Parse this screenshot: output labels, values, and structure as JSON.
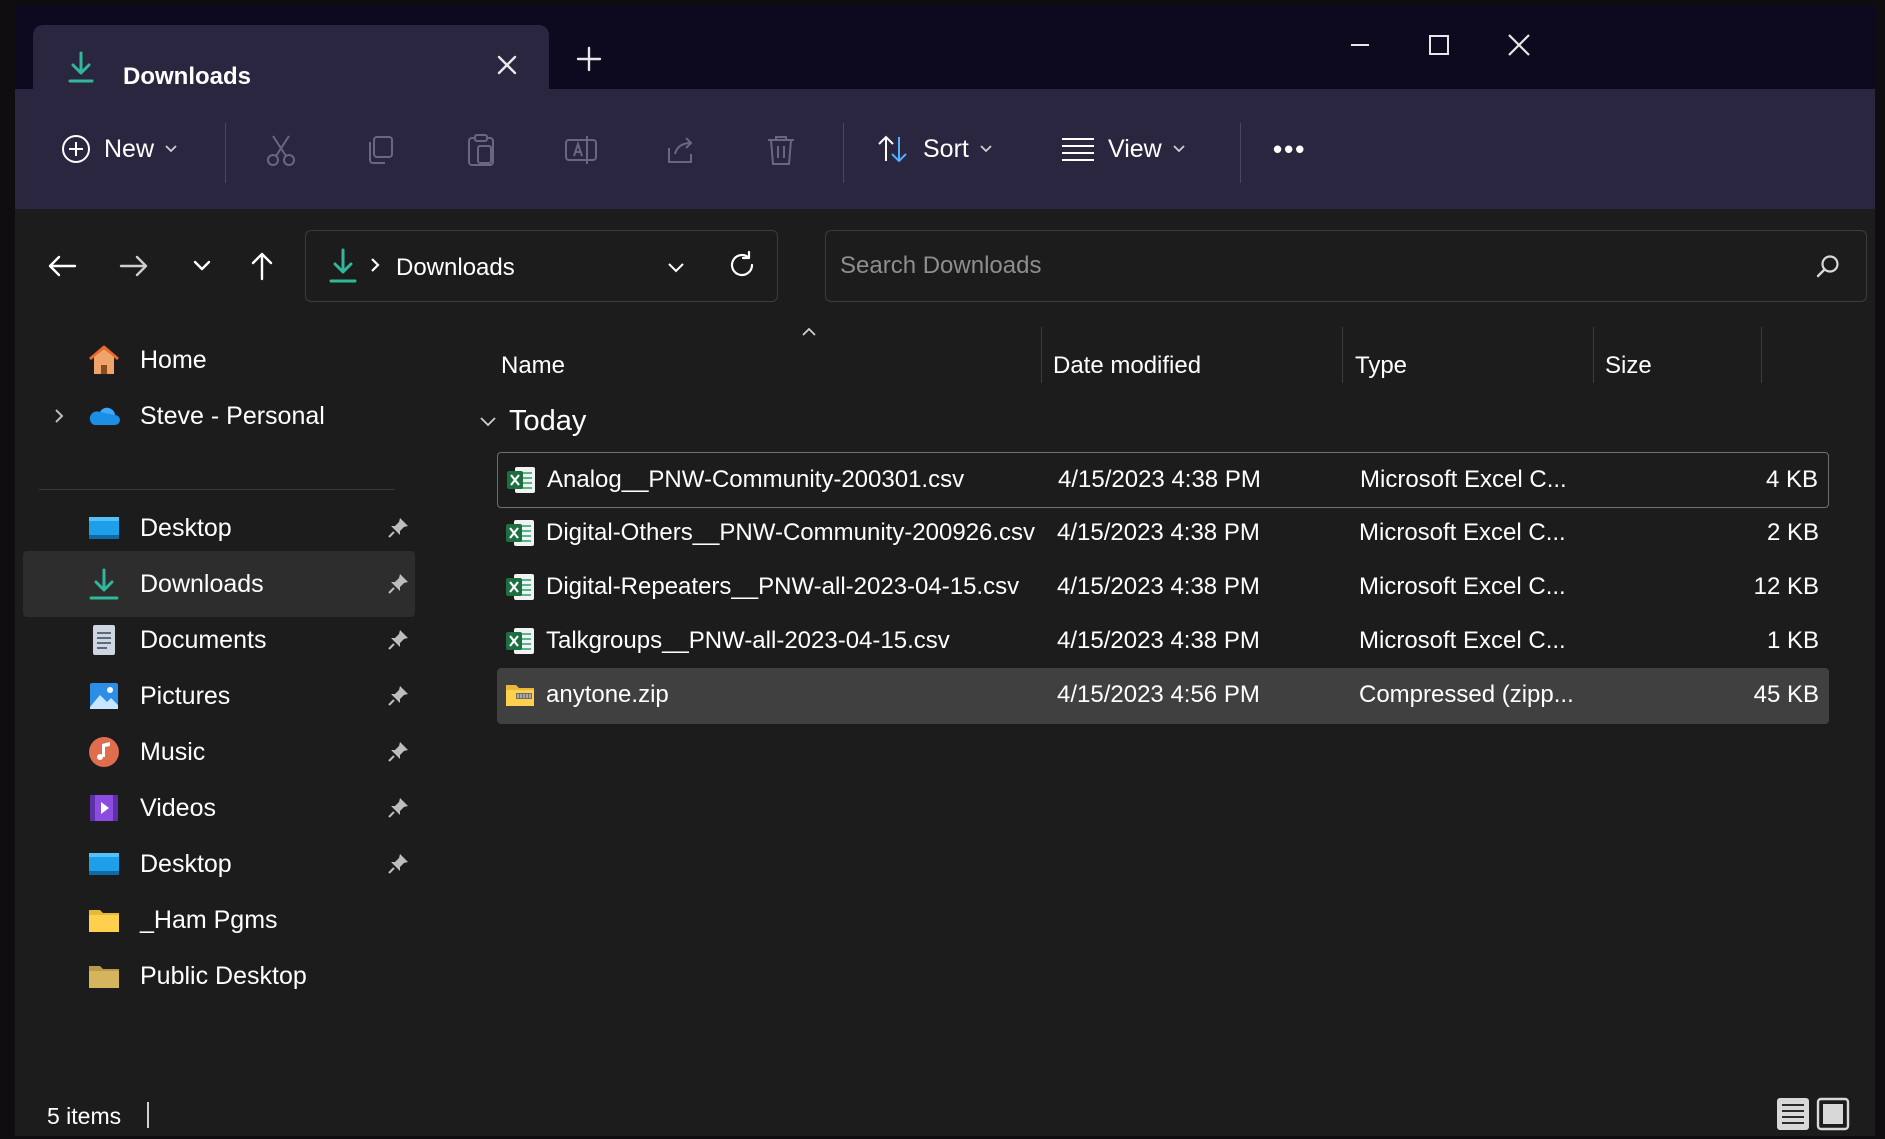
{
  "window": {
    "tab_title": "Downloads",
    "tab_icon": "download-arrow-icon",
    "controls": [
      "minimize-icon",
      "maximize-icon",
      "close-icon"
    ]
  },
  "toolbar": {
    "new_label": "New",
    "sort_label": "Sort",
    "view_label": "View",
    "more_label": "•••",
    "disabled_icons": [
      "cut-icon",
      "copy-icon",
      "paste-icon",
      "rename-icon",
      "share-icon",
      "delete-icon"
    ]
  },
  "address": {
    "crumb": "Downloads"
  },
  "search": {
    "placeholder": "Search Downloads"
  },
  "sidebar": {
    "items": [
      {
        "label": "Home",
        "icon": "home-icon",
        "pinned": false
      },
      {
        "label": "Steve - Personal",
        "icon": "onedrive-cloud-icon",
        "pinned": false
      },
      {
        "label": "Desktop",
        "icon": "desktop-icon",
        "pinned": true
      },
      {
        "label": "Downloads",
        "icon": "download-arrow-icon",
        "pinned": true,
        "active": true
      },
      {
        "label": "Documents",
        "icon": "documents-icon",
        "pinned": true
      },
      {
        "label": "Pictures",
        "icon": "pictures-icon",
        "pinned": true
      },
      {
        "label": "Music",
        "icon": "music-icon",
        "pinned": true
      },
      {
        "label": "Videos",
        "icon": "videos-icon",
        "pinned": true
      },
      {
        "label": "Desktop",
        "icon": "desktop-icon",
        "pinned": true
      },
      {
        "label": "_Ham Pgms",
        "icon": "folder-icon",
        "pinned": false
      },
      {
        "label": "Public Desktop",
        "icon": "folder-icon",
        "pinned": false
      }
    ]
  },
  "filelist": {
    "columns": {
      "name": "Name",
      "date": "Date modified",
      "type": "Type",
      "size": "Size"
    },
    "group": "Today",
    "rows": [
      {
        "name": "Analog__PNW-Community-200301.csv",
        "date": "4/15/2023 4:38 PM",
        "type": "Microsoft Excel C...",
        "size": "4 KB",
        "icon": "excel-csv-icon",
        "state": "focused"
      },
      {
        "name": "Digital-Others__PNW-Community-200926.csv",
        "date": "4/15/2023 4:38 PM",
        "type": "Microsoft Excel C...",
        "size": "2 KB",
        "icon": "excel-csv-icon",
        "state": ""
      },
      {
        "name": "Digital-Repeaters__PNW-all-2023-04-15.csv",
        "date": "4/15/2023 4:38 PM",
        "type": "Microsoft Excel C...",
        "size": "12 KB",
        "icon": "excel-csv-icon",
        "state": ""
      },
      {
        "name": "Talkgroups__PNW-all-2023-04-15.csv",
        "date": "4/15/2023 4:38 PM",
        "type": "Microsoft Excel C...",
        "size": "1 KB",
        "icon": "excel-csv-icon",
        "state": ""
      },
      {
        "name": "anytone.zip",
        "date": "4/15/2023 4:56 PM",
        "type": "Compressed (zipp...",
        "size": "45 KB",
        "icon": "zip-folder-icon",
        "state": "selected"
      }
    ]
  },
  "status": {
    "count": "5 items"
  },
  "colors": {
    "accent": "#2fb89a",
    "titlebar": "#0d0a1f",
    "commandbar": "#2a2640",
    "background": "#1c1c1c",
    "selection": "#404040",
    "excel_green": "#1d6f42"
  }
}
